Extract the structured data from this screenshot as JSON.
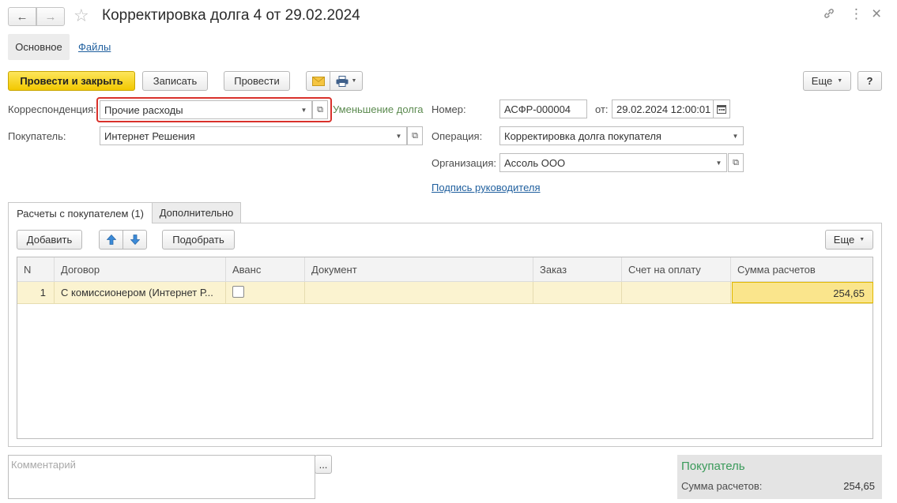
{
  "header": {
    "title": "Корректировка долга 4 от 29.02.2024",
    "back_icon": "←",
    "forward_icon": "→",
    "star_icon": "☆",
    "link_icon": "🔗",
    "more_icon": "⋮",
    "close_icon": "×"
  },
  "tabs": {
    "main": "Основное",
    "files": "Файлы"
  },
  "toolbar": {
    "post_close": "Провести и закрыть",
    "write": "Записать",
    "post": "Провести",
    "more": "Еще",
    "help": "?"
  },
  "form": {
    "correspondence_label": "Корреспонденция:",
    "correspondence_value": "Прочие расходы",
    "debt_reduction": "Уменьшение долга",
    "number_label": "Номер:",
    "number_value": "АСФР-000004",
    "date_label": "от:",
    "date_value": "29.02.2024 12:00:01",
    "buyer_label": "Покупатель:",
    "buyer_value": "Интернет Решения",
    "operation_label": "Операция:",
    "operation_value": "Корректировка долга покупателя",
    "organization_label": "Организация:",
    "organization_value": "Ассоль ООО",
    "signature_link": "Подпись руководителя"
  },
  "panel_tabs": {
    "settlements": "Расчеты с покупателем (1)",
    "additional": "Дополнительно"
  },
  "table_toolbar": {
    "add": "Добавить",
    "pick": "Подобрать",
    "more": "Еще"
  },
  "table": {
    "columns": [
      "N",
      "Договор",
      "Аванс",
      "Документ",
      "Заказ",
      "Счет на оплату",
      "Сумма расчетов"
    ],
    "rows": [
      {
        "n": "1",
        "contract": "С комиссионером (Интернет Р...",
        "advance": false,
        "document": "",
        "order": "",
        "invoice": "",
        "amount": "254,65"
      }
    ]
  },
  "comment": {
    "placeholder": "Комментарий",
    "button": "..."
  },
  "summary": {
    "title": "Покупатель",
    "amount_label": "Сумма расчетов:",
    "amount_value": "254,65"
  },
  "colors": {
    "primary_button": "#f2c800",
    "highlight_border": "#d9312b",
    "link": "#1f5f9e",
    "green_text": "#5b8a4f",
    "selected_row": "#fbf3d0"
  }
}
